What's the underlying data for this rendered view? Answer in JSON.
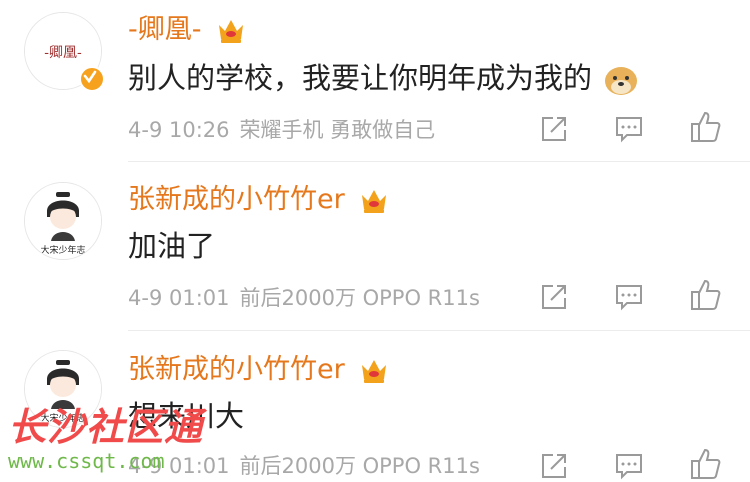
{
  "comments": [
    {
      "username": "-卿凰-",
      "avatar_text": "-卿凰-",
      "content": "别人的学校，我要让你明年成为我的",
      "date": "4-9 10:26",
      "source": "荣耀手机 勇敢做自己"
    },
    {
      "username": "张新成的小竹竹er",
      "avatar_text": "大宋少年志",
      "content": "加油了",
      "date": "4-9 01:01",
      "source": "前后2000万 OPPO R11s"
    },
    {
      "username": "张新成的小竹竹er",
      "avatar_text": "大宋少年志",
      "content": "想来川大",
      "date": "4-9 01:01",
      "source": "前后2000万 OPPO R11s"
    }
  ],
  "icons": {
    "share": "share-icon",
    "comment": "comment-icon",
    "like": "like-icon",
    "crown": "crown-badge-icon",
    "verified": "verified-badge-icon",
    "emoji": "doge-emoji-icon"
  },
  "colors": {
    "username": "#e5781c",
    "meta": "#a8a8a8",
    "crown": "#f2a21b",
    "verified": "#f6a21e",
    "watermark_title": "#f04a4a",
    "watermark_url": "#6fb84a"
  },
  "watermark": {
    "title": "长沙社区通",
    "url": "www.cssqt.com"
  }
}
